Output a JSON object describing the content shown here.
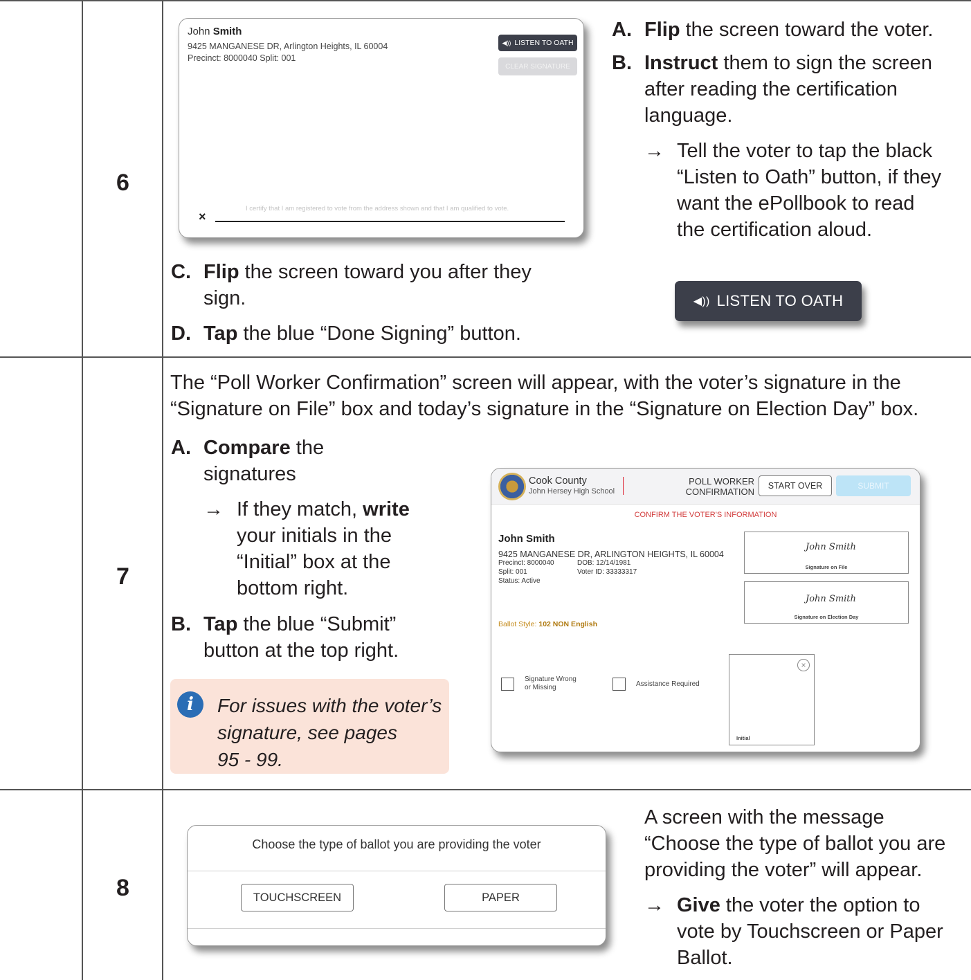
{
  "steps": [
    {
      "number": "6",
      "instructions": {
        "A": {
          "letter": "A.",
          "bold": "Flip",
          "text": " the screen toward the voter."
        },
        "B": {
          "letter": "B.",
          "bold": "Instruct",
          "text_lines": [
            " them to sign the screen",
            "after reading the certification",
            "language."
          ]
        },
        "B_sub": {
          "arrow": "→",
          "lines": [
            "Tell the voter to tap the black",
            "“Listen to Oath” button, if they",
            "want the ePollbook to read",
            "the certification aloud."
          ]
        },
        "C": {
          "letter": "C.",
          "bold": "Flip",
          "text_lines": [
            " the screen toward you after they",
            "sign."
          ]
        },
        "D": {
          "letter": "D.",
          "bold": "Tap",
          "text": " the blue “Done Signing” button."
        }
      },
      "screen": {
        "first_name": "John",
        "last_name": "Smith",
        "address": "9425 MANGANESE DR, Arlington Heights, IL 60004",
        "precinct_split": "Precinct: 8000040 Split: 001",
        "listen_button": "LISTEN TO OATH",
        "clear_button": "CLEAR SIGNATURE",
        "certification": "I certify that I am registered to vote from the address shown and that I am qualified to vote.",
        "x_mark": "×"
      },
      "big_button": {
        "icon": "speaker-icon",
        "label": "LISTEN TO OATH"
      }
    },
    {
      "number": "7",
      "intro_lines": [
        "The “Poll Worker Confirmation” screen will appear, with the voter’s signature in the",
        "“Signature on File” box and today’s signature in the “Signature on Election Day” box."
      ],
      "instructions": {
        "A": {
          "letter": "A.",
          "bold": "Compare",
          "text_lines": [
            " the",
            "signatures"
          ]
        },
        "A_sub": {
          "arrow": "→",
          "pre": "If they match, ",
          "bold": "write",
          "lines": [
            "your initials in the",
            "“Initial” box at the",
            "bottom right."
          ]
        },
        "B": {
          "letter": "B.",
          "bold": "Tap",
          "text_lines": [
            " the blue “Submit”",
            "button at the top right."
          ]
        }
      },
      "note": {
        "icon": "info-icon",
        "glyph": "i",
        "lines": [
          "For issues with the voter’s",
          "signature, see pages",
          "95 - 99."
        ]
      },
      "screen": {
        "county": "Cook County",
        "school": "John Hersey High School",
        "title_line1": "POLL WORKER",
        "title_line2": "CONFIRMATION",
        "start_over": "START OVER",
        "submit": "SUBMIT",
        "confirm_header": "CONFIRM THE VOTER'S INFORMATION",
        "voter_name": "John Smith",
        "address": "9425 MANGANESE DR, ARLINGTON HEIGHTS, IL 60004",
        "precinct": "Precinct: 8000040",
        "dob": "DOB: 12/14/1981",
        "split": "Split: 001",
        "voter_id": "Voter ID: 33333317",
        "status": "Status: Active",
        "ballot_style_label": "Ballot Style: ",
        "ballot_style_value": "102 NON English",
        "signature_scribble": "John Smith",
        "signature_on_file": "Signature on File",
        "signature_election_day": "Signature on Election Day",
        "checkbox1_line1": "Signature Wrong",
        "checkbox1_line2": "or Missing",
        "checkbox2": "Assistance Required",
        "initial_label": "Initial",
        "close_glyph": "×"
      }
    },
    {
      "number": "8",
      "description_lines": [
        "A screen with the message",
        "“Choose the type of ballot you are",
        "providing the voter” will appear."
      ],
      "sub": {
        "arrow": "→",
        "bold": "Give",
        "lines": [
          " the voter the option to",
          "vote by Touchscreen or Paper",
          "Ballot."
        ]
      },
      "screen": {
        "prompt": "Choose the type of ballot you are providing the voter",
        "touchscreen": "TOUCHSCREEN",
        "paper": "PAPER"
      }
    }
  ],
  "colors": {
    "dark_button": "#3c3f4a",
    "submit_blue": "#bde4f7",
    "note_bg": "#fbe3d9",
    "info_blue": "#2a6db5",
    "alert_red": "#d23b3b"
  }
}
